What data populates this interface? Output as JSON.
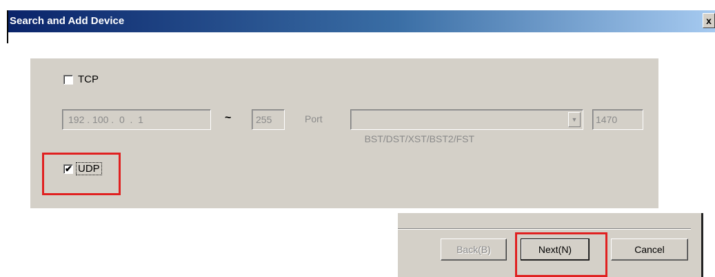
{
  "window": {
    "title": "Search and Add Device",
    "close_glyph": "x"
  },
  "tcp": {
    "label": "TCP",
    "checked": false
  },
  "range": {
    "start_ip": "192 . 100 .  0  .  1",
    "separator": "~",
    "end": "255"
  },
  "port": {
    "label": "Port",
    "protocol_selected": "BST/DST/XST/BST2/FST",
    "number": "1470"
  },
  "udp": {
    "label": "UDP",
    "checked": true,
    "checkmark": "✔"
  },
  "buttons": {
    "back": "Back(B)",
    "next": "Next(N)",
    "cancel": "Cancel"
  },
  "highlight_color": "#e02020",
  "titlebar_color": "#0a246a"
}
